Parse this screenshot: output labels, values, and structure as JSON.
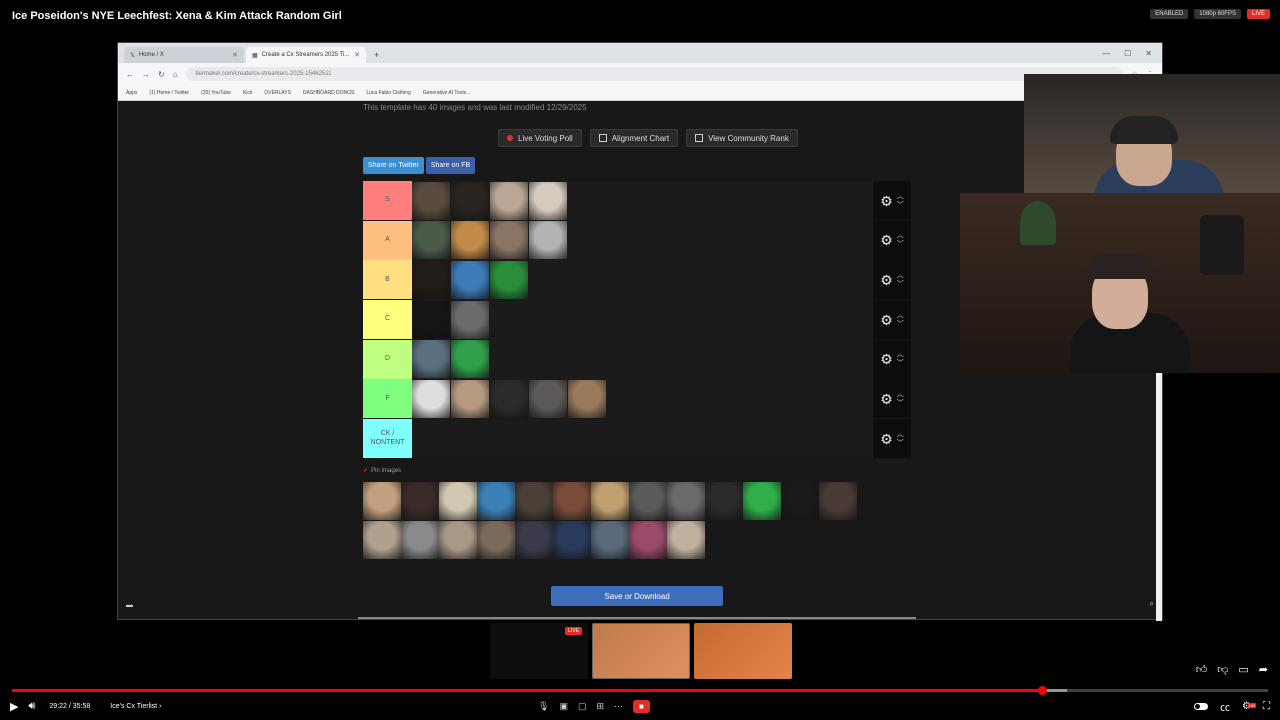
{
  "video": {
    "title": "Ice Poseidon's NYE Leechfest: Xena & Kim Attack Random Girl",
    "badge_enabled": "ENABLED",
    "badge_quality": "1080p 60FPS",
    "badge_live": "LIVE",
    "time": "29:22 / 35:58",
    "chapter": "Ice's Cx Tierlist ›",
    "progress_played_fraction": 0.82,
    "progress_loaded_fraction": 0.84
  },
  "browser": {
    "tabs": [
      {
        "label": "Home / X"
      },
      {
        "label": "Create a Cx Streamers 2025 Ti..."
      }
    ],
    "url": "tiermaker.com/create/cx-streamers-2025-15462511",
    "bookmarks": [
      "Apps",
      "(1) Home / Twitter",
      "(20) YouTube",
      "Kick",
      "OVERLAYS",
      "DASHBOARD DONOS",
      "Luca Fabio Clothing",
      "Generative AI Tools..."
    ]
  },
  "page": {
    "modified_text": "This template has 40 images and was last modified 12/29/2025",
    "buttons": {
      "live_voting": "Live Voting Poll",
      "alignment": "Alignment Chart",
      "community": "View Community Rank"
    },
    "share_twitter": "Share on Twitter",
    "share_fb": "Share on FB",
    "pin_images": "Pin Images",
    "save_button": "Save or Download"
  },
  "tiers": [
    {
      "label": "S",
      "color": "#ff7f7f",
      "count": 4,
      "swatches": [
        "#5b4a3e",
        "#2a2420",
        "#b9a694",
        "#d6c9bd"
      ]
    },
    {
      "label": "A",
      "color": "#ffbf7f",
      "count": 4,
      "swatches": [
        "#4c5a48",
        "#c38a4a",
        "#8a7466",
        "#b3b3b3"
      ]
    },
    {
      "label": "B",
      "color": "#ffdf7f",
      "count": 3,
      "swatches": [
        "#231c17",
        "#3c7bb5",
        "#2a8d39"
      ]
    },
    {
      "label": "C",
      "color": "#ffff7f",
      "count": 2,
      "swatches": [
        "#151515",
        "#6b6b6b"
      ]
    },
    {
      "label": "D",
      "color": "#bfff7f",
      "count": 2,
      "swatches": [
        "#5a7080",
        "#2fa14b"
      ]
    },
    {
      "label": "F",
      "color": "#7fff7f",
      "count": 5,
      "swatches": [
        "#dedede",
        "#b59a80",
        "#2c2a2a",
        "#5c5a58",
        "#9a7a5c"
      ]
    },
    {
      "label": "CK / NONTENT",
      "color": "#7fffff",
      "count": 0,
      "swatches": []
    }
  ],
  "pool_swatches": [
    "#c4a080",
    "#3a2a2a",
    "#d0c8b0",
    "#3b7fb5",
    "#4a4038",
    "#7a4a3a",
    "#c0a070",
    "#5a5a5a",
    "#6a6a6a",
    "#2a2a2a",
    "#2fae4a",
    "#1b1b1b",
    "#4a3a36",
    "#b0a090",
    "#8a8a8a",
    "#a89888",
    "#7a6a5a",
    "#3a3a4a",
    "#2a3a5a",
    "#5a6a7a",
    "#9a4a6a",
    "#c0b0a0"
  ],
  "scenes": {
    "live_tag": "LIVE"
  }
}
